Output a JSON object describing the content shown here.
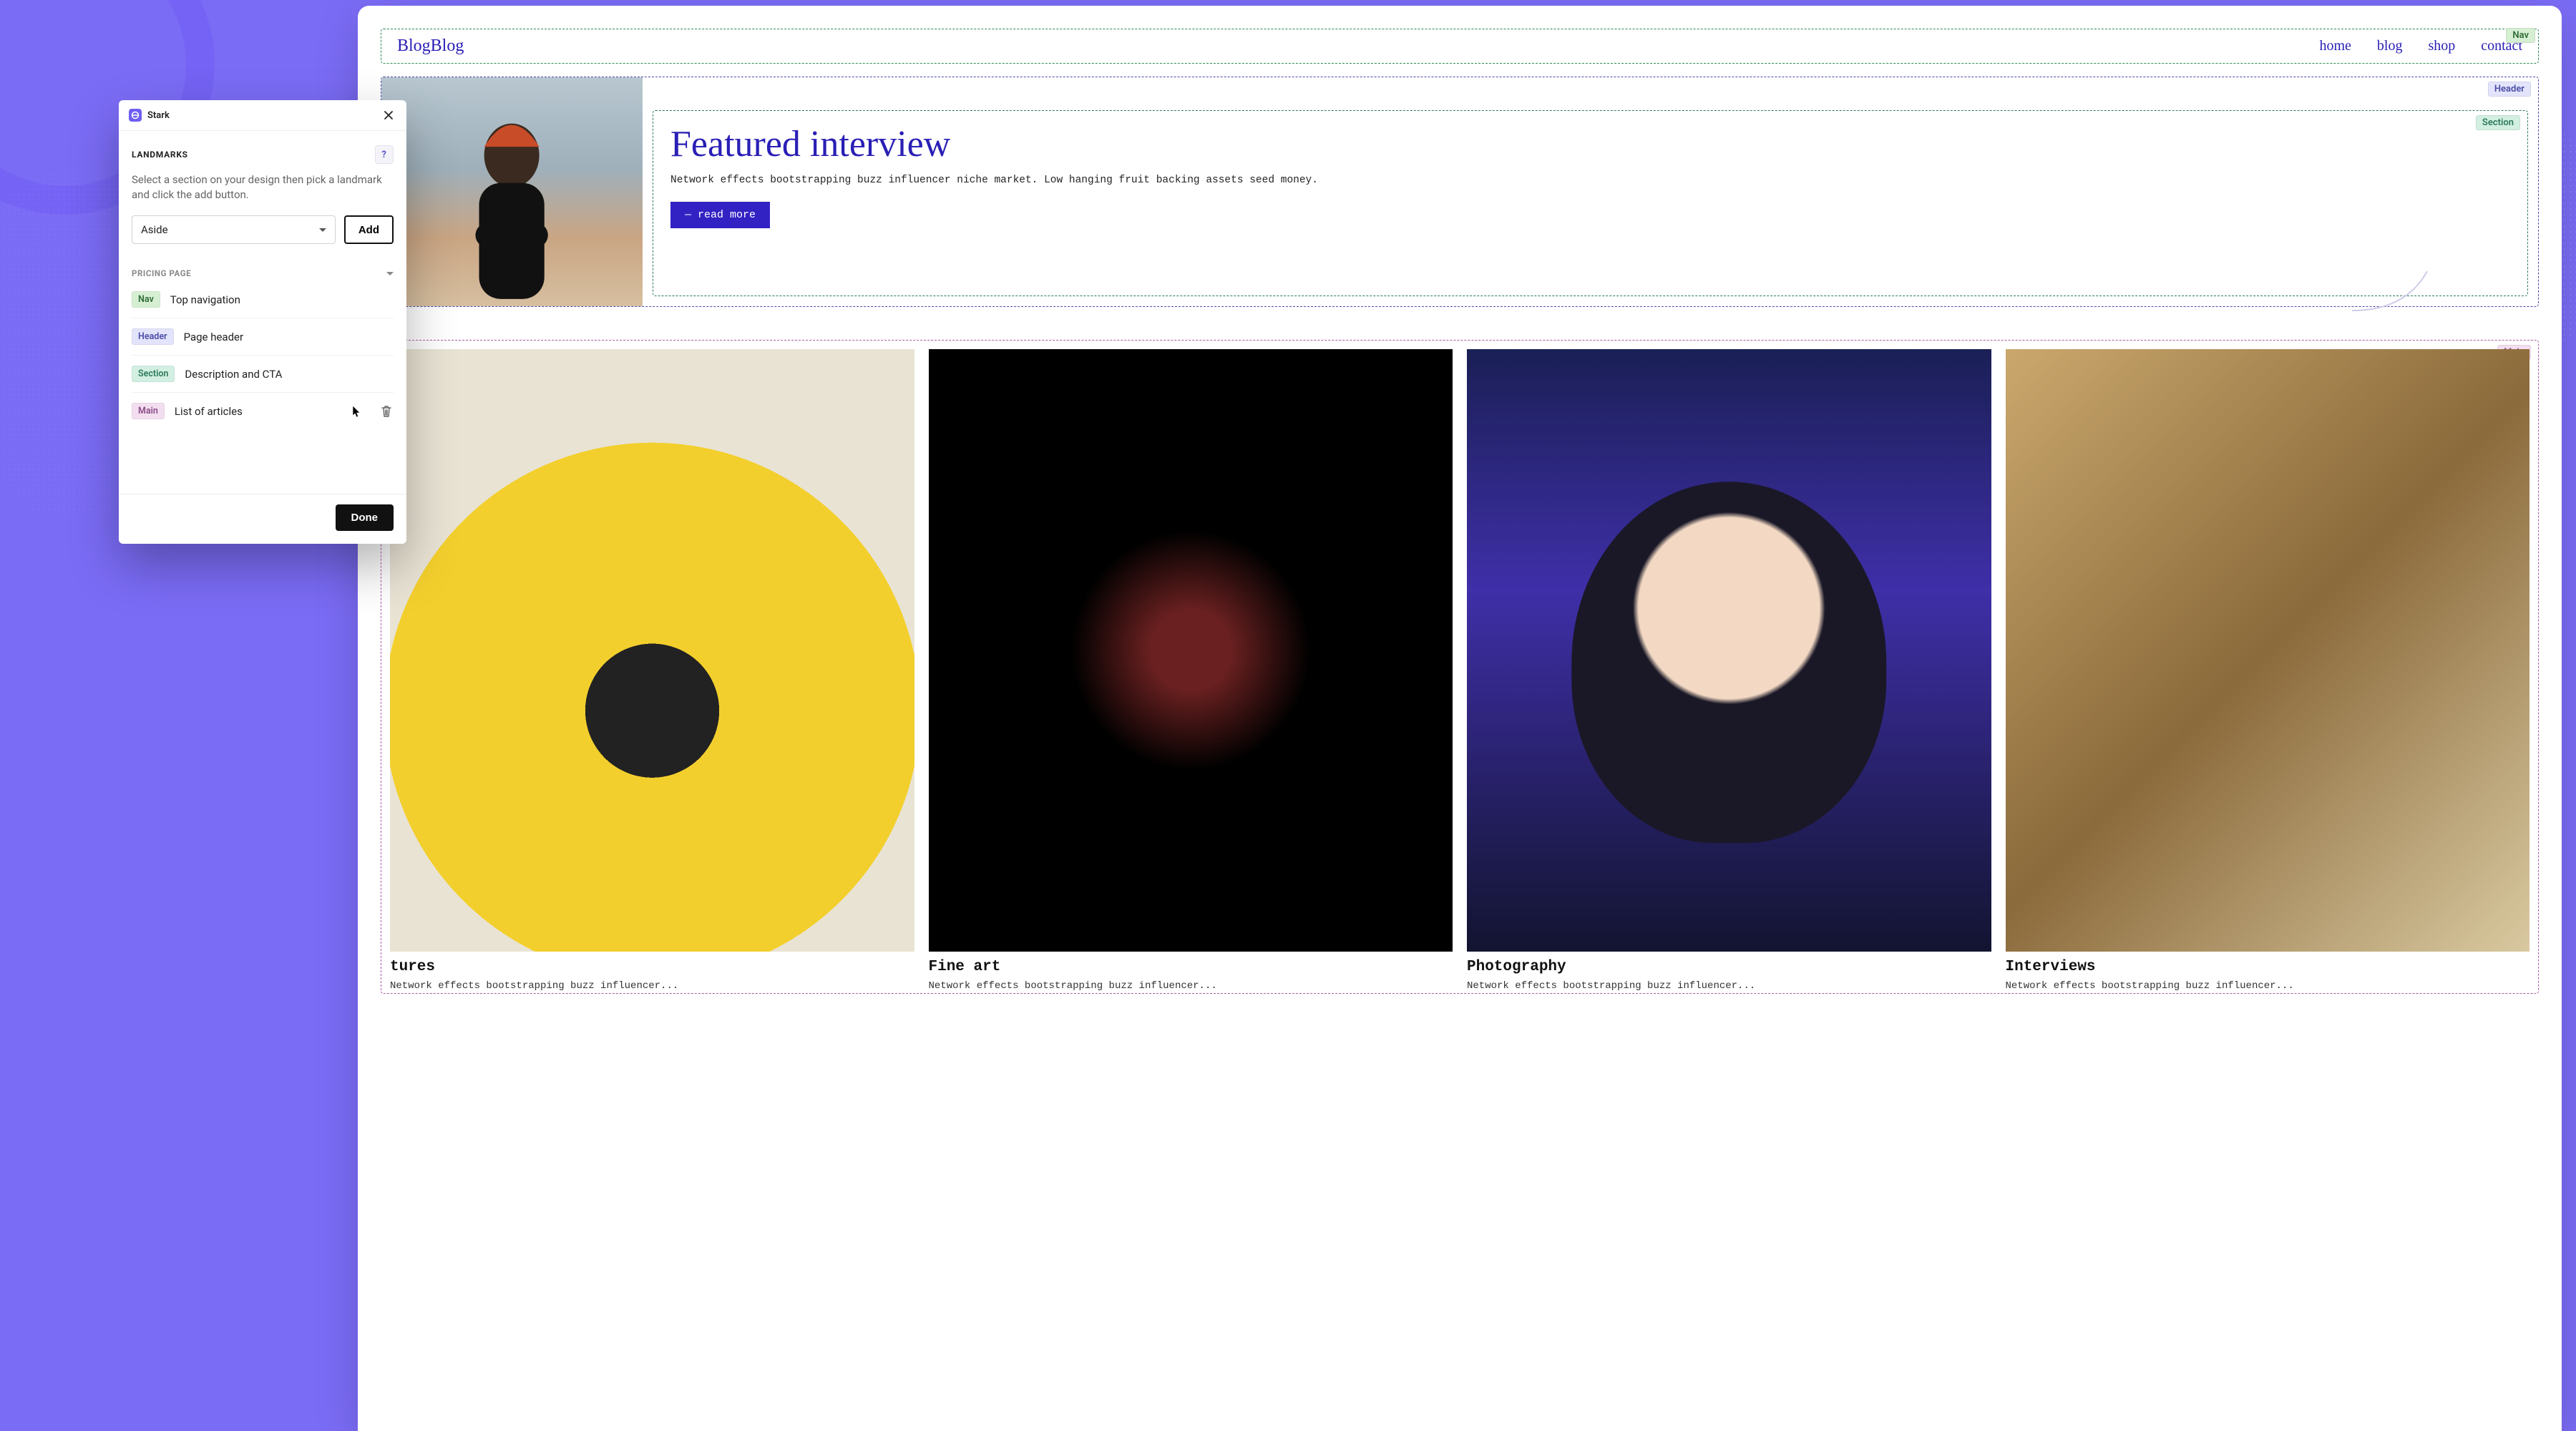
{
  "panel": {
    "app_name": "Stark",
    "section_label": "LANDMARKS",
    "help": "?",
    "hint": "Select a section on your design then pick a landmark and click the add button.",
    "select_value": "Aside",
    "add_label": "Add",
    "group_label": "PRICING PAGE",
    "items": [
      {
        "badge": "Nav",
        "badge_class": "badge-nav",
        "text": "Top navigation"
      },
      {
        "badge": "Header",
        "badge_class": "badge-hdr",
        "text": "Page header"
      },
      {
        "badge": "Section",
        "badge_class": "badge-sec",
        "text": "Description and CTA"
      },
      {
        "badge": "Main",
        "badge_class": "badge-main",
        "text": "List of articles"
      }
    ],
    "done_label": "Done"
  },
  "site": {
    "logo": "BlogBlog",
    "nav": [
      "home",
      "blog",
      "shop",
      "contact"
    ],
    "nav_badge": "Nav",
    "header_badge": "Header",
    "section_badge": "Section",
    "main_badge": "Main",
    "featured_title": "Featured interview",
    "featured_body": "Network effects bootstrapping buzz influencer niche market. Low hanging fruit backing assets seed money.",
    "readmore": "— read more",
    "cards": [
      {
        "title": "tures",
        "body": "Network effects bootstrapping buzz influencer..."
      },
      {
        "title": "Fine art",
        "body": "Network effects bootstrapping buzz influencer..."
      },
      {
        "title": "Photography",
        "body": "Network effects bootstrapping buzz influencer..."
      },
      {
        "title": "Interviews",
        "body": "Network effects bootstrapping buzz influencer..."
      }
    ]
  }
}
